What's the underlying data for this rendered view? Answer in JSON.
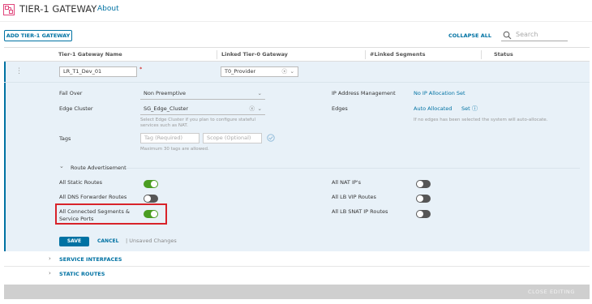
{
  "header": {
    "title": "TIER-1 GATEWAY",
    "sep": "•",
    "about": "About"
  },
  "toolbar": {
    "add_label": "ADD TIER-1 GATEWAY",
    "collapse_label": "COLLAPSE ALL",
    "search_placeholder": "Search"
  },
  "grid": {
    "columns": [
      "Tier-1 Gateway Name",
      "Linked Tier-0 Gateway",
      "#Linked Segments",
      "Status"
    ]
  },
  "edit": {
    "name_value": "LR_T1_Dev_01",
    "required_mark": "*",
    "tier0_value": "T0_Provider",
    "failover_label": "Fail Over",
    "failover_value": "Non Preemptive",
    "edge_cluster_label": "Edge Cluster",
    "edge_cluster_value": "SG_Edge_Cluster",
    "edge_cluster_hint": "Select Edge Cluster if you plan to configure stateful services such as NAT.",
    "ipam_label": "IP Address Management",
    "ipam_value": "No IP Allocation Set",
    "edges_label": "Edges",
    "edges_value": "Auto Allocated",
    "edges_set": "Set",
    "edges_hint": "If no edges has been selected the system will auto-allocate.",
    "tags_label": "Tags",
    "tag_placeholder": "Tag (Required)",
    "scope_placeholder": "Scope (Optional)",
    "tags_hint": "Maximum 30 tags are allowed.",
    "route_adv_label": "Route Advertisement",
    "route_left": [
      {
        "label": "All Static Routes",
        "on": true
      },
      {
        "label": "All DNS Forwarder Routes",
        "on": false
      },
      {
        "label": "All Connected Segments & Service Ports",
        "on": true
      }
    ],
    "route_right": [
      {
        "label": "All NAT IP's",
        "on": false
      },
      {
        "label": "All LB VIP Routes",
        "on": false
      },
      {
        "label": "All LB SNAT IP Routes",
        "on": false
      }
    ],
    "save_label": "SAVE",
    "cancel_label": "CANCEL",
    "unsaved_label": "| Unsaved Changes",
    "service_interfaces_label": "SERVICE INTERFACES",
    "static_routes_label": "STATIC ROUTES"
  },
  "footer": {
    "close_label": "CLOSE EDITING"
  },
  "colors": {
    "accent": "#0072a3",
    "toggle_on": "#4a9d22",
    "toggle_off": "#565656",
    "highlight": "#d8232a"
  }
}
